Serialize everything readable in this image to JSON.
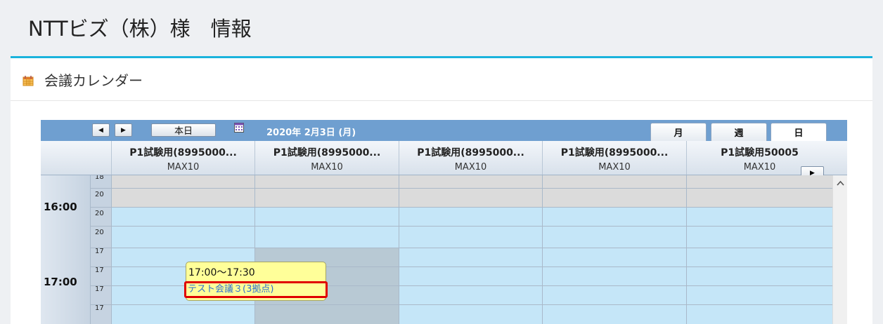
{
  "page": {
    "title": "NTTビズ（株）様　情報"
  },
  "panel": {
    "title": "会議カレンダー",
    "icon": "calendar-icon",
    "accent": "#1ab3dc"
  },
  "toolbar": {
    "prev_icon": "◀",
    "next_icon": "▶",
    "today_label": "本日",
    "date_label": "2020年 2月3日 (月)",
    "view_tabs": [
      "月",
      "週",
      "日"
    ],
    "active_view": "日"
  },
  "rooms": [
    {
      "name": "P1試験用(8995000...",
      "capacity": "MAX10"
    },
    {
      "name": "P1試験用(8995000...",
      "capacity": "MAX10"
    },
    {
      "name": "P1試験用(8995000...",
      "capacity": "MAX10"
    },
    {
      "name": "P1試験用(8995000...",
      "capacity": "MAX10"
    },
    {
      "name": "P1試験用50005",
      "capacity": "MAX10"
    }
  ],
  "hours": [
    "16:00",
    "17:00"
  ],
  "minute_labels": [
    "18",
    "20",
    "20",
    "20",
    "17",
    "17",
    "17",
    "17"
  ],
  "event": {
    "time": "17:00〜17:30",
    "title": "テスト会議３(3拠点)"
  },
  "colors": {
    "toolbar_bg": "#6f9fd0",
    "slot_blue": "#c5e6f8",
    "slot_gray": "#dbdbdb",
    "event_bg": "#ffff99",
    "highlight": "#e00000"
  }
}
